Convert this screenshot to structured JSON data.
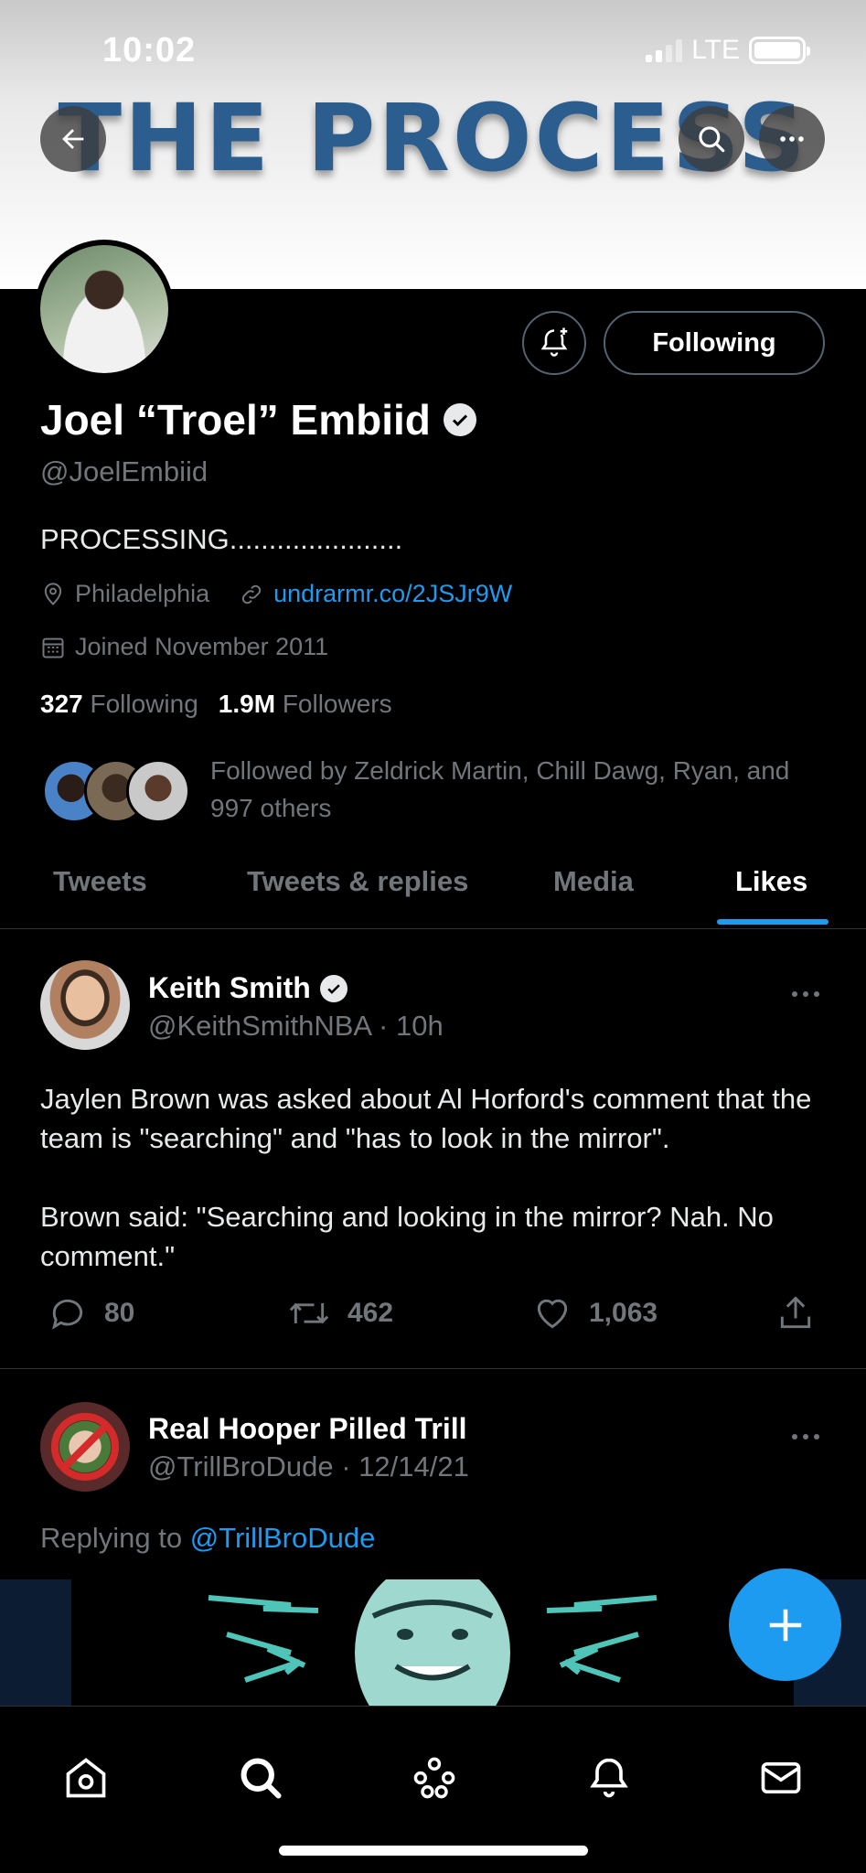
{
  "status_bar": {
    "time": "10:02",
    "network": "LTE"
  },
  "banner": {
    "text": "THE PROCESS"
  },
  "profile": {
    "display_name": "Joel “Troel” Embiid",
    "handle": "@JoelEmbiid",
    "bio": "PROCESSING......................",
    "location": "Philadelphia",
    "website": "undrarmr.co/2JSJr9W",
    "joined": "Joined November 2011",
    "following_count": "327",
    "following_label": "Following",
    "followers_count": "1.9M",
    "followers_label": "Followers",
    "followed_by_line1": "Followed by Zeldrick Martin, Chill Dawg, Ryan, and",
    "followed_by_line2": "997 others",
    "follow_button": "Following"
  },
  "tabs": [
    {
      "label": "Tweets",
      "active": false
    },
    {
      "label": "Tweets & replies",
      "active": false
    },
    {
      "label": "Media",
      "active": false
    },
    {
      "label": "Likes",
      "active": true
    }
  ],
  "tweets": [
    {
      "name": "Keith Smith",
      "verified": true,
      "handle": "@KeithSmithNBA",
      "time": "10h",
      "text_p1": "Jaylen Brown was asked about Al Horford's comment that the team is \"searching\" and \"has to look in the mirror\".",
      "text_p2": "Brown said: \"Searching and looking in the mirror? Nah. No comment.\"",
      "replies": "80",
      "retweets": "462",
      "likes": "1,063"
    },
    {
      "name": "Real Hooper Pilled Trill",
      "verified": false,
      "handle": "@TrillBroDude",
      "time": "12/14/21",
      "replying_prefix": "Replying to",
      "replying_to": "@TrillBroDude"
    }
  ],
  "colors": {
    "accent": "#1d9bf0",
    "banner_text": "#2b5d8f",
    "muted": "#71767b"
  }
}
